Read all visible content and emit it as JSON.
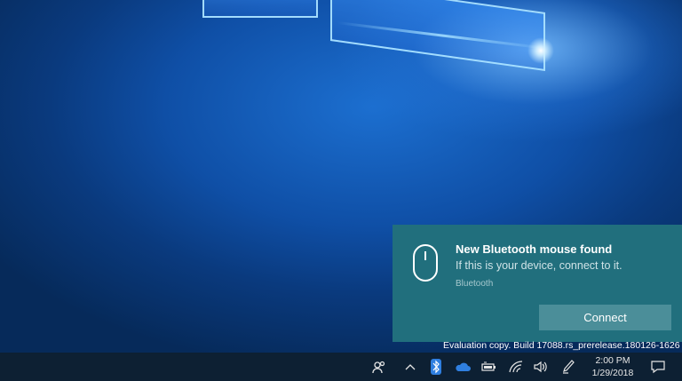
{
  "notification": {
    "title": "New Bluetooth mouse found",
    "body": "If this is your device, connect to it.",
    "source": "Bluetooth",
    "action_label": "Connect",
    "icon": "mouse-icon",
    "accent": "#216f7d"
  },
  "watermark": {
    "text": "Evaluation copy. Build 17088.rs_prerelease.180126-1626"
  },
  "taskbar": {
    "tray_icons": [
      "people-icon",
      "chevron-up-icon",
      "bluetooth-icon",
      "onedrive-icon",
      "battery-icon",
      "wifi-icon",
      "volume-icon",
      "pen-icon"
    ],
    "time": "2:00 PM",
    "date": "1/29/2018",
    "action_center_icon": "action-center-icon",
    "background": "#0d2033"
  }
}
